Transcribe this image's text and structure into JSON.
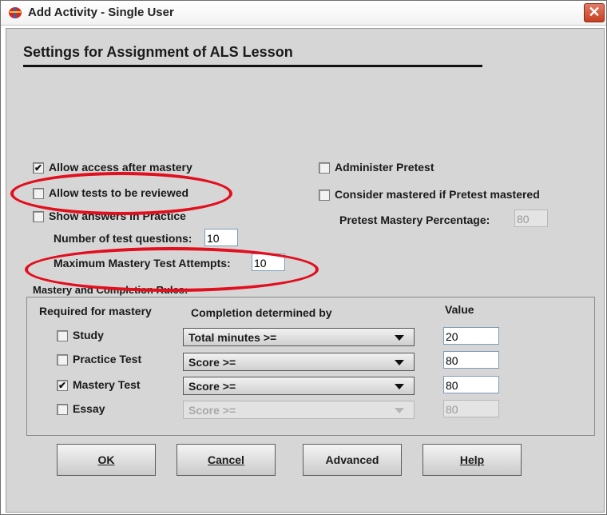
{
  "window": {
    "title": "Add Activity - Single User",
    "close_glyph": "✕",
    "app_icon": "app-icon"
  },
  "heading": "Settings for Assignment of ALS Lesson",
  "options": {
    "allow_access": {
      "label": "Allow access after mastery",
      "checked": true
    },
    "allow_review": {
      "label": "Allow tests to be reviewed",
      "checked": false
    },
    "show_answers": {
      "label": "Show answers in Practice",
      "checked": false
    },
    "num_questions": {
      "label": "Number of test questions:",
      "value": "10"
    },
    "max_attempts": {
      "label": "Maximum Mastery Test Attempts:",
      "value": "10"
    },
    "administer_pretest": {
      "label": "Administer Pretest",
      "checked": false
    },
    "consider_mastered": {
      "label": "Consider mastered if Pretest mastered",
      "checked": false
    },
    "pretest_percentage": {
      "label": "Pretest Mastery Percentage:",
      "value": "80"
    }
  },
  "rules": {
    "title": "Mastery and Completion Rules:",
    "headers": {
      "required": "Required for mastery",
      "completion": "Completion determined by",
      "value": "Value"
    },
    "rows": [
      {
        "name": "Study",
        "checked": false,
        "completion": "Total minutes >=",
        "value": "20",
        "enabled": true
      },
      {
        "name": "Practice Test",
        "checked": false,
        "completion": "Score >=",
        "value": "80",
        "enabled": true
      },
      {
        "name": "Mastery Test",
        "checked": true,
        "completion": "Score >=",
        "value": "80",
        "enabled": true
      },
      {
        "name": "Essay",
        "checked": false,
        "completion": "Score >=",
        "value": "80",
        "enabled": false
      }
    ]
  },
  "buttons": {
    "ok": "OK",
    "cancel": "Cancel",
    "advanced": "Advanced",
    "help": "Help"
  },
  "colors": {
    "highlight_oval": "#e20f1e",
    "dialog_bg": "#d6d6d6"
  }
}
